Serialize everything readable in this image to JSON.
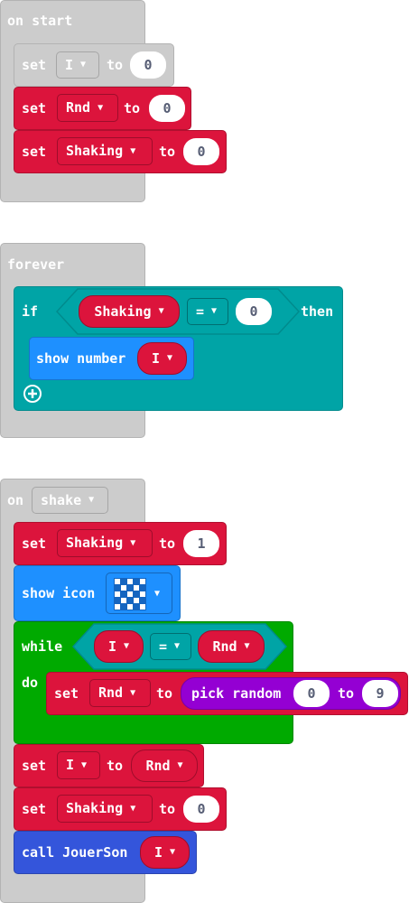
{
  "on_start": {
    "title": "on start",
    "stmt1": {
      "set": "set",
      "var": "I",
      "to": "to",
      "value": "0"
    },
    "stmt2": {
      "set": "set",
      "var": "Rnd",
      "to": "to",
      "value": "0"
    },
    "stmt3": {
      "set": "set",
      "var": "Shaking",
      "to": "to",
      "value": "0"
    }
  },
  "forever": {
    "title": "forever",
    "if_label": "if",
    "then_label": "then",
    "cond": {
      "left": "Shaking",
      "op": "=",
      "right": "0"
    },
    "show_number": {
      "label": "show number",
      "var": "I"
    }
  },
  "on_shake": {
    "on": "on",
    "event": "shake",
    "stmt1": {
      "set": "set",
      "var": "Shaking",
      "to": "to",
      "value": "1"
    },
    "show_icon": {
      "label": "show icon"
    },
    "while_loop": {
      "while_label": "while",
      "do_label": "do",
      "cond": {
        "left": "I",
        "op": "=",
        "right": "Rnd"
      },
      "body": {
        "set": "set",
        "var": "Rnd",
        "to": "to",
        "pick": "pick random",
        "from": "0",
        "to2": "to",
        "max": "9"
      }
    },
    "stmt3": {
      "set": "set",
      "var": "I",
      "to": "to",
      "value": "Rnd"
    },
    "stmt4": {
      "set": "set",
      "var": "Shaking",
      "to": "to",
      "value": "0"
    },
    "call": {
      "label": "call JouerSon",
      "arg": "I"
    }
  }
}
